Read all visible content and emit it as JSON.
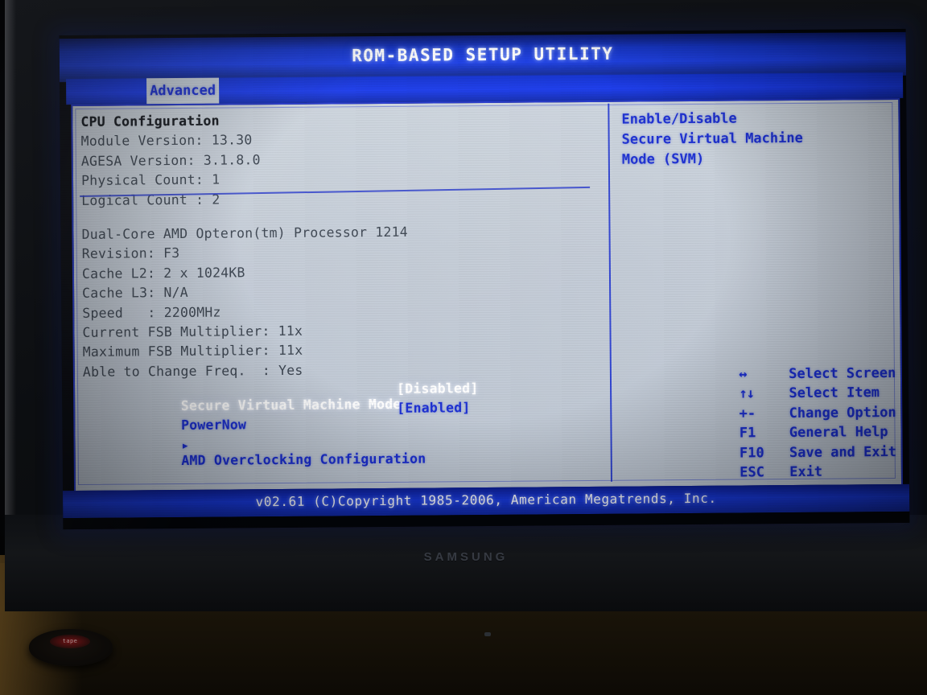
{
  "title": "ROM-BASED SETUP UTILITY",
  "menu": {
    "active_tab": "Advanced"
  },
  "left_panel": {
    "section_title": "CPU Configuration",
    "info_rows": [
      {
        "label": "Module Version: 13.30"
      },
      {
        "label": "AGESA Version: 3.1.8.0"
      },
      {
        "label": "Physical Count: 1"
      },
      {
        "label": "Logical Count : 2"
      }
    ],
    "cpu_rows": [
      {
        "label": "Dual-Core AMD Opteron(tm) Processor 1214"
      },
      {
        "label": "Revision: F3"
      },
      {
        "label": "Cache L2: 2 x 1024KB"
      },
      {
        "label": "Cache L3: N/A"
      },
      {
        "label": "Speed   : 2200MHz"
      },
      {
        "label": "Current FSB Multiplier: 11x"
      },
      {
        "label": "Maximum FSB Multiplier: 11x"
      },
      {
        "label": "Able to Change Freq.  : Yes"
      }
    ],
    "settings": [
      {
        "label": "Secure Virtual Machine Mode",
        "value": "[Disabled]",
        "selected": true
      },
      {
        "label": "PowerNow",
        "value": "[Enabled]",
        "selected": false
      }
    ],
    "submenu": {
      "marker": "▸",
      "label": "AMD Overclocking Configuration"
    }
  },
  "right_panel": {
    "help_lines": [
      "Enable/Disable",
      "Secure Virtual Machine",
      "Mode (SVM)"
    ],
    "key_legend": [
      {
        "key": "↔",
        "action": "Select Screen"
      },
      {
        "key": "↑↓",
        "action": "Select Item"
      },
      {
        "key": "+-",
        "action": "Change Option"
      },
      {
        "key": "F1",
        "action": "General Help"
      },
      {
        "key": "F10",
        "action": "Save and Exit"
      },
      {
        "key": "ESC",
        "action": "Exit"
      }
    ]
  },
  "footer": {
    "text": "v02.61 (C)Copyright 1985-2006, American Megatrends, Inc."
  },
  "hardware": {
    "monitor_brand": "SAMSUNG",
    "desk_object_label": "tape"
  },
  "colors": {
    "title_blue": "#1c3fe6",
    "menu_blue": "#1a3bec",
    "panel_bg": "#c4ccd7",
    "text_blue": "#1c2fd2",
    "text_dark": "#3b4450",
    "selected_white": "#ffffff",
    "border_blue": "#2438cf"
  }
}
